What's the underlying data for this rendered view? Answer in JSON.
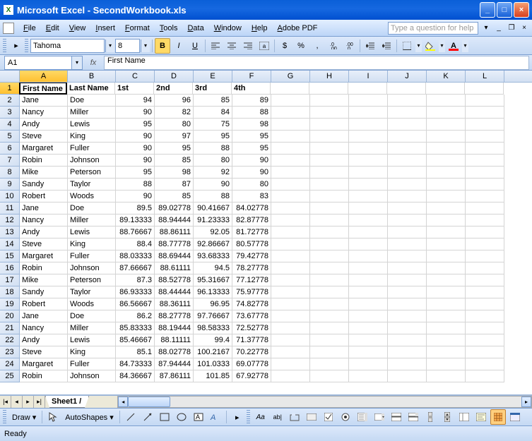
{
  "app": {
    "name": "Microsoft Excel",
    "file": "SecondWorkbook.xls"
  },
  "menus": [
    "File",
    "Edit",
    "View",
    "Insert",
    "Format",
    "Tools",
    "Data",
    "Window",
    "Help",
    "Adobe PDF"
  ],
  "help_placeholder": "Type a question for help",
  "font": {
    "name": "Tahoma",
    "size": "8"
  },
  "name_box": "A1",
  "formula": "First Name",
  "columns": [
    "A",
    "B",
    "C",
    "D",
    "E",
    "F",
    "G",
    "H",
    "I",
    "J",
    "K",
    "L"
  ],
  "headers": [
    "First Name",
    "Last Name",
    "1st",
    "2nd",
    "3rd",
    "4th"
  ],
  "rows": [
    [
      "Jane",
      "Doe",
      "94",
      "96",
      "85",
      "89"
    ],
    [
      "Nancy",
      "Miller",
      "90",
      "82",
      "84",
      "88"
    ],
    [
      "Andy",
      "Lewis",
      "95",
      "80",
      "75",
      "98"
    ],
    [
      "Steve",
      "King",
      "90",
      "97",
      "95",
      "95"
    ],
    [
      "Margaret",
      "Fuller",
      "90",
      "95",
      "88",
      "95"
    ],
    [
      "Robin",
      "Johnson",
      "90",
      "85",
      "80",
      "90"
    ],
    [
      "Mike",
      "Peterson",
      "95",
      "98",
      "92",
      "90"
    ],
    [
      "Sandy",
      "Taylor",
      "88",
      "87",
      "90",
      "80"
    ],
    [
      "Robert",
      "Woods",
      "90",
      "85",
      "88",
      "83"
    ],
    [
      "Jane",
      "Doe",
      "89.5",
      "89.02778",
      "90.41667",
      "84.02778"
    ],
    [
      "Nancy",
      "Miller",
      "89.13333",
      "88.94444",
      "91.23333",
      "82.87778"
    ],
    [
      "Andy",
      "Lewis",
      "88.76667",
      "88.86111",
      "92.05",
      "81.72778"
    ],
    [
      "Steve",
      "King",
      "88.4",
      "88.77778",
      "92.86667",
      "80.57778"
    ],
    [
      "Margaret",
      "Fuller",
      "88.03333",
      "88.69444",
      "93.68333",
      "79.42778"
    ],
    [
      "Robin",
      "Johnson",
      "87.66667",
      "88.61111",
      "94.5",
      "78.27778"
    ],
    [
      "Mike",
      "Peterson",
      "87.3",
      "88.52778",
      "95.31667",
      "77.12778"
    ],
    [
      "Sandy",
      "Taylor",
      "86.93333",
      "88.44444",
      "96.13333",
      "75.97778"
    ],
    [
      "Robert",
      "Woods",
      "86.56667",
      "88.36111",
      "96.95",
      "74.82778"
    ],
    [
      "Jane",
      "Doe",
      "86.2",
      "88.27778",
      "97.76667",
      "73.67778"
    ],
    [
      "Nancy",
      "Miller",
      "85.83333",
      "88.19444",
      "98.58333",
      "72.52778"
    ],
    [
      "Andy",
      "Lewis",
      "85.46667",
      "88.11111",
      "99.4",
      "71.37778"
    ],
    [
      "Steve",
      "King",
      "85.1",
      "88.02778",
      "100.2167",
      "70.22778"
    ],
    [
      "Margaret",
      "Fuller",
      "84.73333",
      "87.94444",
      "101.0333",
      "69.07778"
    ],
    [
      "Robin",
      "Johnson",
      "84.36667",
      "87.86111",
      "101.85",
      "67.92778"
    ]
  ],
  "sheet_tab": "Sheet1",
  "draw": {
    "label": "Draw",
    "autoshapes": "AutoShapes"
  },
  "status": "Ready"
}
